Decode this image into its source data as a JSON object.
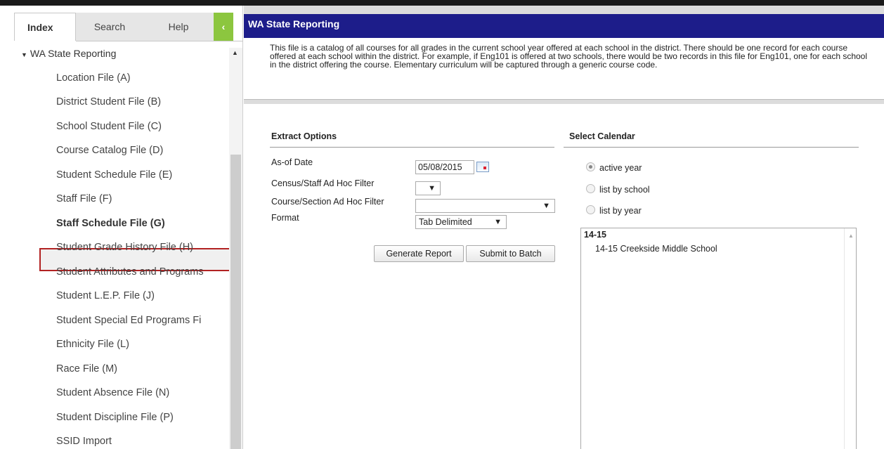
{
  "tabs": {
    "index": "Index",
    "search": "Search",
    "help": "Help",
    "collapse": "‹"
  },
  "tree": {
    "parent": "WA State Reporting",
    "items": [
      "Location File (A)",
      "District Student File (B)",
      "School Student File (C)",
      "Course Catalog File (D)",
      "Student Schedule File (E)",
      "Staff File (F)",
      "Staff Schedule File (G)",
      "Student Grade History File (H)",
      "Student Attributes and Programs",
      "Student L.E.P. File (J)",
      "Student Special Ed Programs Fi",
      "Ethnicity File (L)",
      "Race File (M)",
      "Student Absence File (N)",
      "Student Discipline File (P)",
      "SSID Import"
    ],
    "selected_index": 6
  },
  "header": {
    "title": "WA State Reporting"
  },
  "description": "This file is a catalog of all courses for all grades in the current school year offered at each school in the district. There should be one record for each course offered at each school within the district. For example, if Eng101 is offered at two schools, there would be two records in this file for Eng101, one for each school in the district offering the course. Elementary curriculum will be captured through a generic course code.",
  "extract": {
    "title": "Extract Options",
    "as_of_label": "As-of Date",
    "as_of_value": "05/08/2015",
    "census_label": "Census/Staff Ad Hoc Filter",
    "census_value": "",
    "course_label": "Course/Section Ad Hoc Filter",
    "course_value": "",
    "format_label": "Format",
    "format_value": "Tab Delimited",
    "generate_button": "Generate Report",
    "batch_button": "Submit to Batch"
  },
  "calendar": {
    "title": "Select Calendar",
    "options": [
      "active year",
      "list by school",
      "list by year"
    ],
    "selected_option": 0,
    "group": "14-15",
    "items": [
      "14-15 Creekside Middle School"
    ]
  },
  "colors": {
    "header_bg": "#1d1d8a",
    "collapse_tab": "#8cc63f",
    "selection_border": "#b22222"
  }
}
